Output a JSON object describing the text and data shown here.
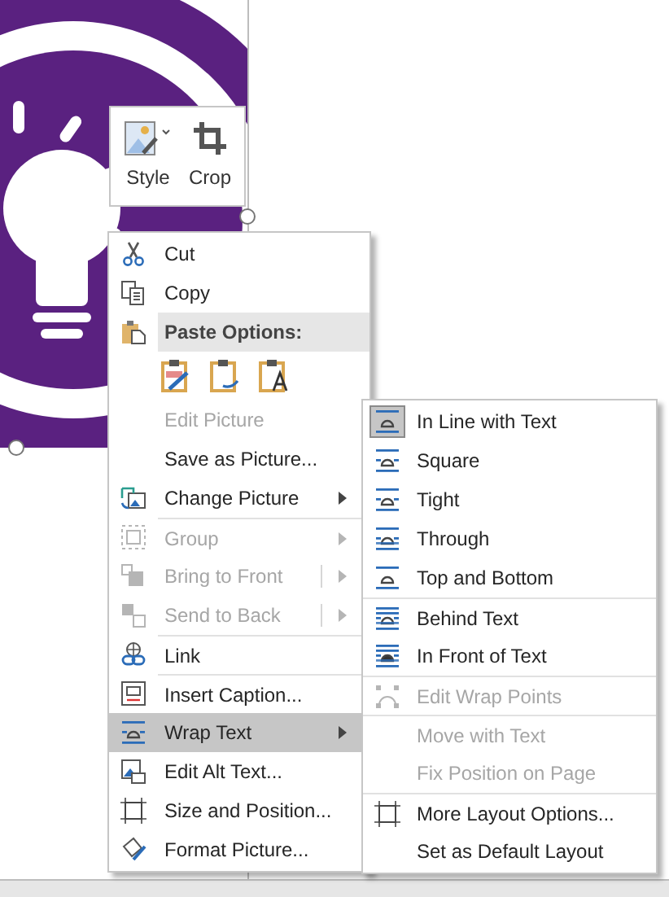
{
  "mini_toolbar": {
    "buttons": [
      {
        "label": "Style",
        "kind": "style"
      },
      {
        "label": "Crop",
        "kind": "crop"
      }
    ]
  },
  "menu": {
    "items": [
      {
        "label": "Cut",
        "kind": "cut",
        "disabled": false,
        "has_submenu": false,
        "selected": false,
        "separator_before": false
      },
      {
        "label": "Copy",
        "kind": "copy",
        "disabled": false,
        "has_submenu": false,
        "selected": false,
        "separator_before": false
      },
      {
        "label": "Paste Options:",
        "kind": "paste-header",
        "has_submenu": false,
        "selected": false,
        "separator_before": false
      },
      {
        "kind": "paste-buttons",
        "options": [
          {
            "kind": "keep-format"
          },
          {
            "kind": "merge"
          },
          {
            "kind": "text-only"
          }
        ]
      },
      {
        "label": "Edit Picture",
        "kind": "none",
        "disabled": true,
        "has_submenu": false,
        "selected": false,
        "separator_before": false
      },
      {
        "label": "Save as Picture...",
        "kind": "none",
        "disabled": false,
        "has_submenu": false,
        "selected": false,
        "separator_before": false
      },
      {
        "label": "Change Picture",
        "kind": "change-picture",
        "disabled": false,
        "has_submenu": true,
        "selected": false,
        "separator_before": false
      },
      {
        "label": "Group",
        "kind": "group",
        "disabled": true,
        "has_submenu": true,
        "selected": false,
        "separator_before": true
      },
      {
        "label": "Bring to Front",
        "kind": "front",
        "disabled": true,
        "has_submenu": true,
        "selected": false,
        "separator_before": false
      },
      {
        "label": "Send to Back",
        "kind": "back",
        "disabled": true,
        "has_submenu": true,
        "selected": false,
        "separator_before": false
      },
      {
        "label": "Link",
        "kind": "link",
        "disabled": false,
        "has_submenu": false,
        "selected": false,
        "separator_before": true
      },
      {
        "label": "Insert Caption...",
        "kind": "caption",
        "disabled": false,
        "has_submenu": false,
        "selected": false,
        "separator_before": true
      },
      {
        "label": "Wrap Text",
        "kind": "wrap",
        "disabled": false,
        "has_submenu": true,
        "selected": true,
        "separator_before": false
      },
      {
        "label": "Edit Alt Text...",
        "kind": "alt-text",
        "disabled": false,
        "has_submenu": false,
        "selected": false,
        "separator_before": false
      },
      {
        "label": "Size and Position...",
        "kind": "size",
        "disabled": false,
        "has_submenu": false,
        "selected": false,
        "separator_before": false
      },
      {
        "label": "Format Picture...",
        "kind": "format",
        "disabled": false,
        "has_submenu": false,
        "selected": false,
        "separator_before": false
      }
    ]
  },
  "submenu": {
    "items": [
      {
        "label": "In Line with Text",
        "kind": "wrap-inline",
        "disabled": false,
        "checked": true,
        "separator_before": false
      },
      {
        "label": "Square",
        "kind": "wrap-square",
        "disabled": false,
        "checked": false,
        "separator_before": false
      },
      {
        "label": "Tight",
        "kind": "wrap-tight",
        "disabled": false,
        "checked": false,
        "separator_before": false
      },
      {
        "label": "Through",
        "kind": "wrap-through",
        "disabled": false,
        "checked": false,
        "separator_before": false
      },
      {
        "label": "Top and Bottom",
        "kind": "wrap-topbottom",
        "disabled": false,
        "checked": false,
        "separator_before": false
      },
      {
        "label": "Behind Text",
        "kind": "wrap-behind",
        "disabled": false,
        "checked": false,
        "separator_before": true
      },
      {
        "label": "In Front of Text",
        "kind": "wrap-front",
        "disabled": false,
        "checked": false,
        "separator_before": false
      },
      {
        "label": "Edit Wrap Points",
        "kind": "wrap-points",
        "disabled": true,
        "checked": false,
        "separator_before": true
      },
      {
        "label": "Move with Text",
        "kind": "none",
        "disabled": true,
        "checked": false,
        "separator_before": true
      },
      {
        "label": "Fix Position on Page",
        "kind": "none",
        "disabled": true,
        "checked": false,
        "separator_before": false
      },
      {
        "label": "More Layout Options...",
        "kind": "size",
        "disabled": false,
        "checked": false,
        "separator_before": true
      },
      {
        "label": "Set as Default Layout",
        "kind": "none",
        "disabled": false,
        "checked": false,
        "separator_before": false
      }
    ]
  }
}
